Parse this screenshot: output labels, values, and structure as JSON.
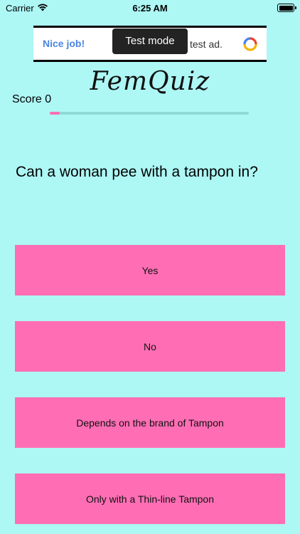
{
  "status_bar": {
    "carrier": "Carrier",
    "time": "6:25 AM",
    "wifi_icon": "wifi-icon",
    "battery_icon": "battery-icon"
  },
  "ad": {
    "title": "Nice job!",
    "text": "test ad.",
    "badge": "Test mode",
    "logo_icon": "ad-choices-logo-icon",
    "title_color": "#4a86e0"
  },
  "app": {
    "title": "FemQuiz",
    "background_color": "#adf7f5",
    "accent_color": "#ff6eb5"
  },
  "score": {
    "label": "Score 0",
    "progress_fraction": 0.05
  },
  "question": {
    "text": "Can a woman pee with a tampon in?"
  },
  "answers": [
    {
      "label": "Yes"
    },
    {
      "label": "No"
    },
    {
      "label": "Depends on the brand of Tampon"
    },
    {
      "label": "Only with a Thin-line Tampon"
    }
  ]
}
